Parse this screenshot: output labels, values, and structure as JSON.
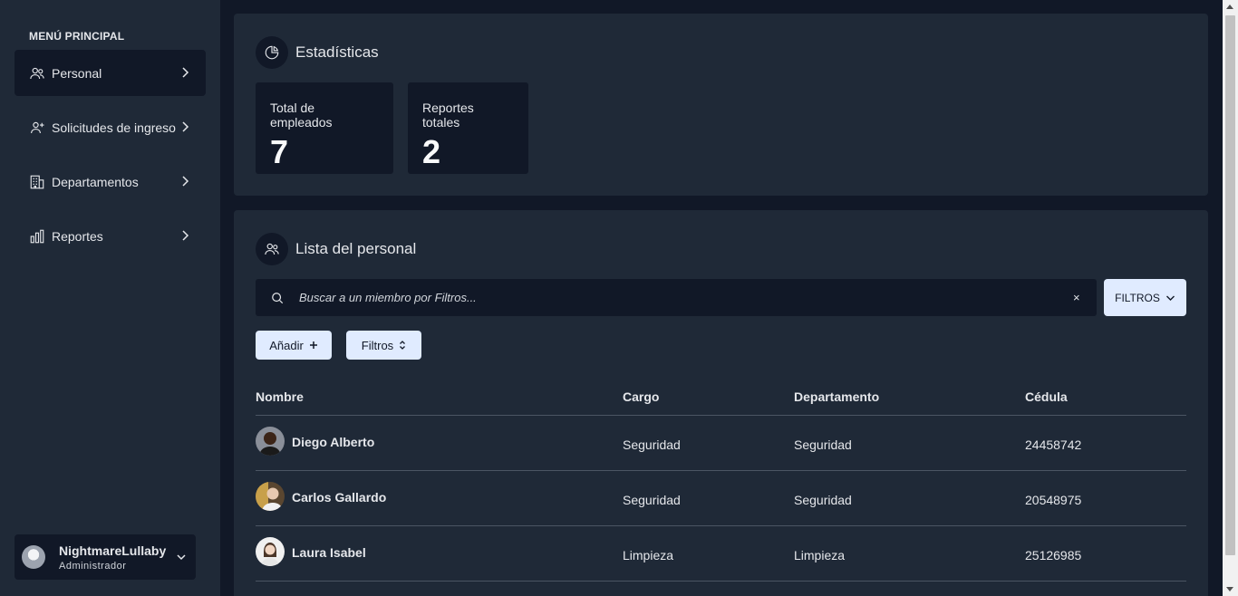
{
  "sidebar": {
    "menu_title": "MENÚ PRINCIPAL",
    "items": [
      {
        "label": "Personal",
        "icon": "users-icon",
        "active": true
      },
      {
        "label": "Solicitudes de ingreso",
        "icon": "user-plus-icon",
        "active": false
      },
      {
        "label": "Departamentos",
        "icon": "building-icon",
        "active": false
      },
      {
        "label": "Reportes",
        "icon": "bar-chart-icon",
        "active": false
      }
    ],
    "user": {
      "name": "NightmareLullaby",
      "role": "Administrador"
    }
  },
  "stats": {
    "title": "Estadísticas",
    "cards": [
      {
        "label": "Total de empleados",
        "value": "7"
      },
      {
        "label": "Reportes totales",
        "value": "2"
      }
    ]
  },
  "list": {
    "title": "Lista del personal",
    "search_placeholder": "Buscar a un miembro por Filtros...",
    "clear_label": "×",
    "filtros_top_label": "FILTROS",
    "add_label": "Añadir",
    "filtros_label": "Filtros",
    "columns": [
      "Nombre",
      "Cargo",
      "Departamento",
      "Cédula"
    ],
    "rows": [
      {
        "name": "Diego Alberto",
        "cargo": "Seguridad",
        "departamento": "Seguridad",
        "cedula": "24458742"
      },
      {
        "name": "Carlos Gallardo",
        "cargo": "Seguridad",
        "departamento": "Seguridad",
        "cedula": "20548975"
      },
      {
        "name": "Laura Isabel",
        "cargo": "Limpieza",
        "departamento": "Limpieza",
        "cedula": "25126985"
      }
    ]
  },
  "colors": {
    "background": "#111827",
    "panel": "#1f2937",
    "button_light": "#e0ebff",
    "text": "#e5e7eb"
  }
}
